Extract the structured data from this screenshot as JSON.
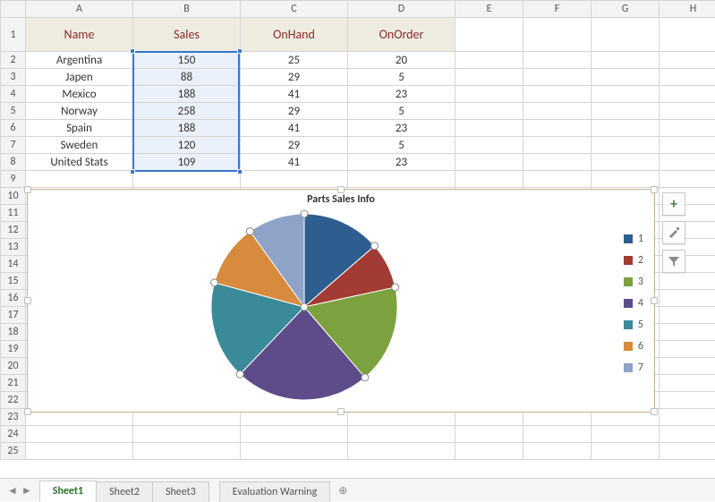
{
  "columns": [
    "A",
    "B",
    "C",
    "D",
    "E",
    "F",
    "G",
    "H"
  ],
  "rows_visible": 25,
  "headers": {
    "A": "Name",
    "B": "Sales",
    "C": "OnHand",
    "D": "OnOrder"
  },
  "data": [
    {
      "name": "Argentina",
      "sales": 150,
      "onhand": 25,
      "onorder": 20
    },
    {
      "name": "Japen",
      "sales": 88,
      "onhand": 29,
      "onorder": 5
    },
    {
      "name": "Mexico",
      "sales": 188,
      "onhand": 41,
      "onorder": 23
    },
    {
      "name": "Norway",
      "sales": 258,
      "onhand": 29,
      "onorder": 5
    },
    {
      "name": "Spain",
      "sales": 188,
      "onhand": 41,
      "onorder": 23
    },
    {
      "name": "Sweden",
      "sales": 120,
      "onhand": 29,
      "onorder": 5
    },
    {
      "name": "United Stats",
      "sales": 109,
      "onhand": 41,
      "onorder": 23
    }
  ],
  "selection": {
    "col": "B",
    "row_start": 2,
    "row_end": 8
  },
  "chart_data": {
    "type": "pie",
    "title": "Parts Sales Info",
    "categories": [
      "1",
      "2",
      "3",
      "4",
      "5",
      "6",
      "7"
    ],
    "values": [
      150,
      88,
      188,
      258,
      188,
      120,
      109
    ],
    "colors": [
      "#2e5e8f",
      "#a13b34",
      "#7ba23f",
      "#5e4c8a",
      "#3b8a99",
      "#d78b3c",
      "#8fa3c9"
    ],
    "legend_position": "right"
  },
  "side_buttons": {
    "add": "+",
    "style": "brush",
    "filter": "filter"
  },
  "tabs": [
    "Sheet1",
    "Sheet2",
    "Sheet3"
  ],
  "active_tab": "Sheet1",
  "warning_tab": "Evaluation Warning"
}
